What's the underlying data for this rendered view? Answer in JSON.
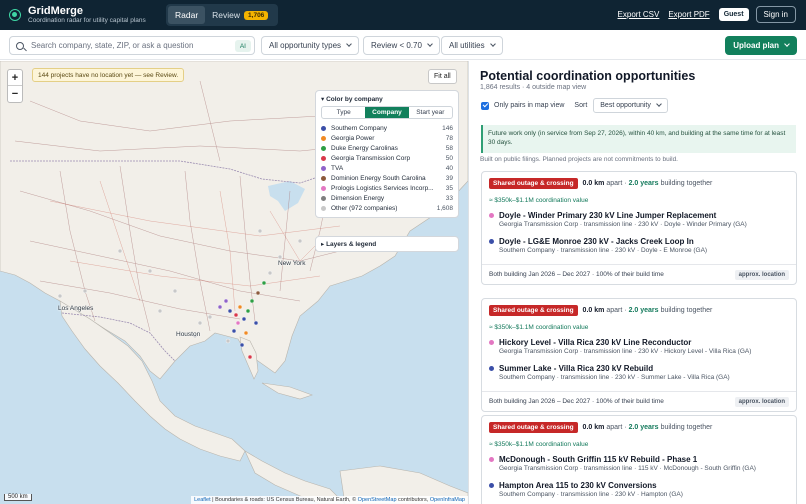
{
  "header": {
    "title": "GridMerge",
    "subtitle": "Coordination radar for utility capital plans",
    "tab_radar": "Radar",
    "tab_review": "Review",
    "review_count": "1,706",
    "export_csv": "Export CSV",
    "export_pdf": "Export PDF",
    "guest": "Guest",
    "sign_in": "Sign in"
  },
  "toolbar": {
    "search_placeholder": "Search company, state, ZIP, or ask a question",
    "ai_label": "AI",
    "opportunity_types": "All opportunity types",
    "review_filter": "Review < 0.70",
    "utilities": "All utilities",
    "upload_plan": "Upload plan"
  },
  "map": {
    "zoom_in": "+",
    "zoom_out": "−",
    "notice": "144 projects have no location yet — see Review.",
    "fit_all": "Fit all",
    "color_by_title": "▾ Color by company",
    "seg_type": "Type",
    "seg_company": "Company",
    "seg_start": "Start year",
    "layers_legend": "▸ Layers & legend",
    "scale": "500 km",
    "attribution": {
      "leaflet": "Leaflet",
      "text1": " | Boundaries & roads: US Census Bureau, Natural Earth, © ",
      "osm": "OpenStreetMap",
      "text2": " contributors, ",
      "oim": "OpenInfraMap"
    },
    "cities": {
      "new_york": "New York",
      "los_angeles": "Los Angeles",
      "houston": "Houston"
    },
    "companies": [
      {
        "name": "Southern Company",
        "count": "146",
        "color": "#3b4fa8"
      },
      {
        "name": "Georgia Power",
        "count": "78",
        "color": "#f08a24"
      },
      {
        "name": "Duke Energy Carolinas",
        "count": "58",
        "color": "#2e9e44"
      },
      {
        "name": "Georgia Transmission Corp",
        "count": "50",
        "color": "#d9384a"
      },
      {
        "name": "TVA",
        "count": "40",
        "color": "#8f63c9"
      },
      {
        "name": "Dominion Energy South Carolina",
        "count": "39",
        "color": "#8c5a3c"
      },
      {
        "name": "Prologis Logistics Services Incorp...",
        "count": "35",
        "color": "#e377c2"
      },
      {
        "name": "Dimension Energy",
        "count": "33",
        "color": "#7f7f7f"
      },
      {
        "name": "Other (972 companies)",
        "count": "1,608",
        "color": "#c8c8c8"
      }
    ]
  },
  "results": {
    "title": "Potential coordination opportunities",
    "summary": "1,864 results · 4 outside map view",
    "only_pairs": "Only pairs in map view",
    "sort_label": "Sort",
    "sort_value": "Best opportunity",
    "info": "Future work only (in service from Sep 27, 2026), within 40 km, and building at the same time for at least 30 days.",
    "note": "Built on public filings. Planned projects are not commitments to build.",
    "cards": [
      {
        "badge": "Shared outage & crossing",
        "distance": "0.0 km",
        "apart": "apart ·",
        "years": "2.0 years",
        "together": "building together",
        "value": "≈ $350k–$1.1M coordination value",
        "p1_name": "Doyle - Winder Primary 230 kV Line Jumper Replacement",
        "p1_meta": "Georgia Transmission Corp · transmission line · 230 kV · Doyle - Winder Primary (GA)",
        "p1_color": "#e377c2",
        "p2_name": "Doyle - LG&E Monroe 230 kV - Jacks Creek Loop In",
        "p2_meta": "Southern Company · transmission line · 230 kV · Doyle - E Monroe (GA)",
        "p2_color": "#3b4fa8",
        "footer": "Both building Jan 2026 – Dec 2027 · 100% of their build time",
        "approx": "approx. location"
      },
      {
        "badge": "Shared outage & crossing",
        "distance": "0.0 km",
        "apart": "apart ·",
        "years": "2.0 years",
        "together": "building together",
        "value": "≈ $350k–$1.1M coordination value",
        "p1_name": "Hickory Level - Villa Rica 230 kV Line Reconductor",
        "p1_meta": "Georgia Transmission Corp · transmission line · 230 kV · Hickory Level - Villa Rica (GA)",
        "p1_color": "#e377c2",
        "p2_name": "Summer Lake - Villa Rica 230 kV Rebuild",
        "p2_meta": "Southern Company · transmission line · 230 kV · Summer Lake - Villa Rica (GA)",
        "p2_color": "#3b4fa8",
        "footer": "Both building Jan 2026 – Dec 2027 · 100% of their build time",
        "approx": "approx. location"
      },
      {
        "badge": "Shared outage & crossing",
        "distance": "0.0 km",
        "apart": "apart ·",
        "years": "2.0 years",
        "together": "building together",
        "value": "≈ $350k–$1.1M coordination value",
        "p1_name": "McDonough - South Griffin 115 kV Rebuild - Phase 1",
        "p1_meta": "Georgia Transmission Corp · transmission line · 115 kV · McDonough - South Griffin (GA)",
        "p1_color": "#e377c2",
        "p2_name": "Hampton Area 115 to 230 kV Conversions",
        "p2_meta": "Southern Company · transmission line · 230 kV · Hampton (GA)",
        "p2_color": "#3b4fa8",
        "footer": "",
        "approx": ""
      }
    ]
  }
}
